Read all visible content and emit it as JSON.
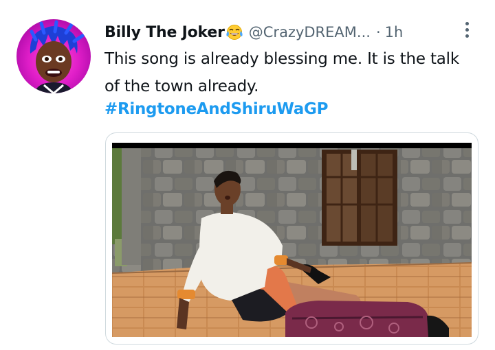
{
  "tweet": {
    "author_name": "Billy The Joker",
    "author_emoji_icon": "face-with-tears-of-joy-icon",
    "handle": "@CrazyDREAM...",
    "separator": "·",
    "timestamp": "1h",
    "text": "This song is already blessing me. It is the talk of the town already.",
    "hashtag": "#RingtoneAndShiruWaGP",
    "media": {
      "kind": "video-thumbnail"
    }
  },
  "colors": {
    "text": "#0f1419",
    "secondary": "#536471",
    "link": "#1d9bf0",
    "avatar_bg": "#e01ec8"
  }
}
